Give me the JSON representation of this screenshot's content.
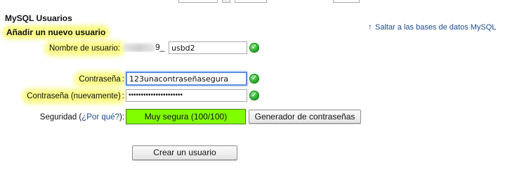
{
  "header": {
    "title": "MySQL Usuarios",
    "section_title": "Añadir un nuevo usuario",
    "jump_link": "Saltar a las bases de datos MySQL"
  },
  "form": {
    "username_label": "Nombre de usuario:",
    "username_prefix_suffix": "9_",
    "username_value": "usbd2",
    "password_label": "Contraseña",
    "password_value": "123unacontraseñasegura",
    "password_confirm_label": "Contraseña (nuevamente)",
    "password_confirm_mask": "••••••••••••••••••••••",
    "security_label_start": "Seguridad (",
    "security_why_link": "¿Por qué?",
    "security_label_end": "):",
    "strength_text": "Muy segura (100/100)",
    "generator_button": "Generador de contraseñas",
    "create_button": "Crear un usuario"
  },
  "colors": {
    "strength_bar": "#80ff00",
    "highlight": "#fbfb8b",
    "link": "#1b4d88",
    "valid_check": "#1e9b1e"
  },
  "icons": {
    "valid": "check-circle-icon",
    "jump": "arrow-up-icon"
  }
}
